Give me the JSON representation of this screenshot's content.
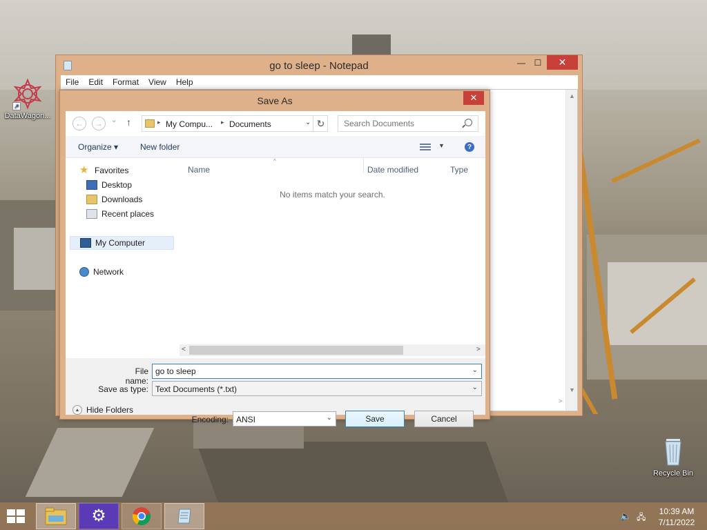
{
  "desktop": {
    "icons": [
      {
        "label": "DataWagon..."
      },
      {
        "label": "Recycle Bin"
      }
    ]
  },
  "notepad": {
    "title": "go to sleep - Notepad",
    "menu": [
      "File",
      "Edit",
      "Format",
      "View",
      "Help"
    ],
    "minimize": "—",
    "maximize": "☐",
    "close": "✕"
  },
  "save_as": {
    "title": "Save As",
    "close": "✕",
    "nav": {
      "back": "←",
      "forward": "→",
      "recent": "⌄",
      "up": "↑",
      "refresh": "↻"
    },
    "breadcrumb": [
      "My Compu...",
      "Documents"
    ],
    "search_placeholder": "Search Documents",
    "toolbar": {
      "organize": "Organize ▾",
      "new_folder": "New folder",
      "help": "?"
    },
    "nav_pane": {
      "favorites": "Favorites",
      "desktop": "Desktop",
      "downloads": "Downloads",
      "recent_places": "Recent places",
      "my_computer": "My Computer",
      "network": "Network"
    },
    "columns": [
      "Name",
      "Date modified",
      "Type"
    ],
    "empty_message": "No items match your search.",
    "file_name_label": "File name:",
    "file_name_value": "go to sleep",
    "save_as_type_label": "Save as type:",
    "save_as_type_value": "Text Documents (*.txt)",
    "hide_folders": "Hide Folders",
    "encoding_label": "Encoding:",
    "encoding_value": "ANSI",
    "save_button": "Save",
    "cancel_button": "Cancel"
  },
  "taskbar": {
    "apps": [
      {
        "icon": "file-explorer-icon",
        "active": true
      },
      {
        "icon": "settings-gear-icon",
        "active": false
      },
      {
        "icon": "chrome-icon",
        "active": false
      },
      {
        "icon": "notepad-icon",
        "active": true
      }
    ],
    "time": "10:39 AM",
    "date": "7/11/2022"
  },
  "colors": {
    "window_frame": "#dfb18a",
    "close_red": "#c7403a",
    "taskbar": "#967656",
    "settings_purple": "#5b3bb5"
  }
}
